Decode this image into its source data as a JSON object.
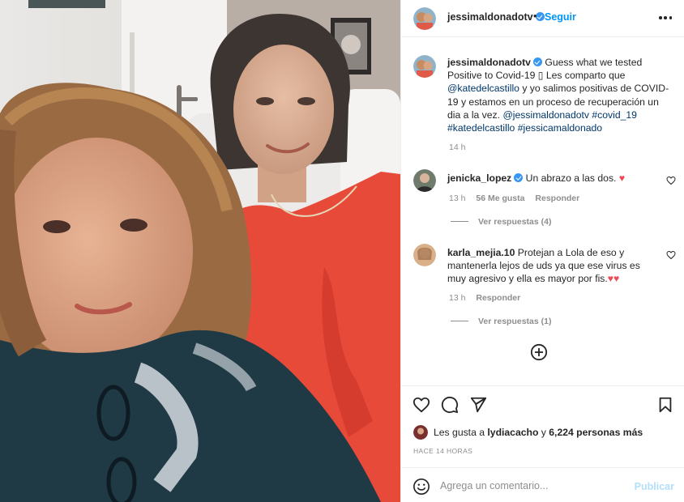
{
  "header": {
    "username": "jessimaldonadotv",
    "separator": "•",
    "follow_label": "Seguir",
    "more_icon": "more-horizontal-icon"
  },
  "caption": {
    "username": "jessimaldonadotv",
    "text_1": "Guess what we tested Positive to Covid-19 ▯ Les comparto que ",
    "mention_1": "@katedelcastillo",
    "text_2": " y yo salimos positivas de COVID-19 y estamos en un proceso de recuperación un dia a la vez. ",
    "mention_2": "@jessimaldonadotv",
    "hashtag_1": "#covid_19",
    "mention_3": "#katedelcastillo",
    "hashtag_2": "#jessicamaldonado",
    "time": "14 h"
  },
  "comments": [
    {
      "username": "jenicka_lopez",
      "verified": true,
      "text": "Un abrazo a las dos.",
      "emoji": "♥",
      "time": "13 h",
      "likes": "56 Me gusta",
      "reply_label": "Responder",
      "view_replies": "Ver respuestas (4)"
    },
    {
      "username": "karla_mejia.10",
      "verified": false,
      "text": "Protejan a Lola de eso y mantenerla lejos de uds ya que ese virus es muy agresivo y ella es mayor por fis.",
      "emoji": "♥♥",
      "time": "13 h",
      "reply_label": "Responder",
      "view_replies": "Ver respuestas (1)"
    }
  ],
  "load_more_icon": "plus-circle-icon",
  "actions": {
    "icons": [
      "heart-icon",
      "comment-icon",
      "share-icon",
      "bookmark-icon"
    ],
    "likes_prefix": "Les gusta a ",
    "likes_user": "lydiacacho",
    "likes_middle": " y ",
    "likes_count": "6,224 personas más",
    "post_time": "HACE 14 HORAS"
  },
  "comment_input": {
    "placeholder": "Agrega un comentario...",
    "publish_label": "Publicar"
  },
  "colors": {
    "link_blue": "#0095f6",
    "tag_blue": "#00376b",
    "muted": "#8e8e8e",
    "heart_red": "#ed4956",
    "publish_disabled": "#b2dffc"
  }
}
